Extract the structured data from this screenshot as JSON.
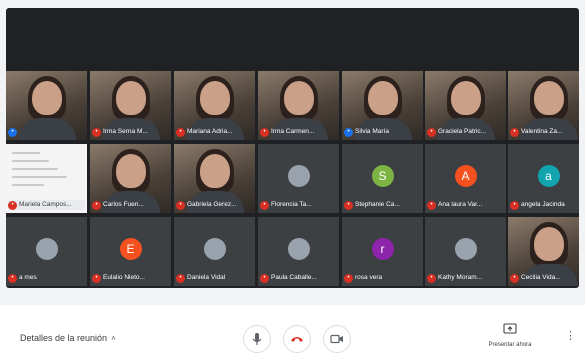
{
  "colors": {
    "stage": "#202124",
    "mic_muted": "#d93025",
    "hangup": "#d93025",
    "bottom_bar": "#ffffff"
  },
  "participants": [
    {
      "name": "",
      "kind": "video",
      "mic": "on"
    },
    {
      "name": "Irma Serna M...",
      "kind": "video",
      "mic": "muted"
    },
    {
      "name": "Mariana Adria...",
      "kind": "video",
      "mic": "muted"
    },
    {
      "name": "Irma Carmen...",
      "kind": "video",
      "mic": "muted"
    },
    {
      "name": "Silvia María",
      "kind": "video",
      "mic": "on"
    },
    {
      "name": "Graciela Patric...",
      "kind": "video",
      "mic": "muted"
    },
    {
      "name": "Valentina Za...",
      "kind": "video",
      "mic": "muted"
    },
    {
      "name": "Mariela Campos...",
      "kind": "screen",
      "mic": "muted"
    },
    {
      "name": "Carlos Fuen...",
      "kind": "video",
      "mic": "muted"
    },
    {
      "name": "Gabriela Gerez...",
      "kind": "video",
      "mic": "muted"
    },
    {
      "name": "Florencia Ta...",
      "kind": "avatar-photo",
      "mic": "muted"
    },
    {
      "name": "Stephanie Ca...",
      "kind": "avatar",
      "initial": "S",
      "color": "#7cb342",
      "mic": "muted"
    },
    {
      "name": "Ana laura Var...",
      "kind": "avatar",
      "initial": "A",
      "color": "#f4511e",
      "mic": "muted"
    },
    {
      "name": "angela Jacinda",
      "kind": "avatar",
      "initial": "a",
      "color": "#12a4af",
      "mic": "muted"
    },
    {
      "name": "a mes",
      "kind": "avatar-photo",
      "mic": "muted"
    },
    {
      "name": "Eulalio Nieto...",
      "kind": "avatar",
      "initial": "E",
      "color": "#f4511e",
      "mic": "muted"
    },
    {
      "name": "Daniela Vidal",
      "kind": "avatar-photo",
      "mic": "muted"
    },
    {
      "name": "Paula Caballe...",
      "kind": "avatar-photo",
      "mic": "muted"
    },
    {
      "name": "rosa vera",
      "kind": "avatar",
      "initial": "r",
      "color": "#8e24aa",
      "mic": "muted"
    },
    {
      "name": "Kathy Moram...",
      "kind": "avatar-photo",
      "mic": "muted"
    },
    {
      "name": "Cecilia Vida...",
      "kind": "video",
      "mic": "muted"
    }
  ],
  "bottom_bar": {
    "meeting_details_label": "Detalles de la reunión",
    "present_label": "Presentar ahora",
    "mic_icon": "mic-icon",
    "hangup_icon": "hangup-icon",
    "camera_icon": "camera-icon",
    "more_icon": "more-vert-icon"
  }
}
